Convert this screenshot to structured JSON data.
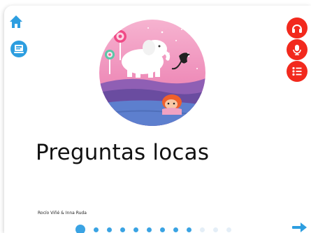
{
  "book": {
    "title": "Preguntas locas",
    "authors": "Rocío Viñé & Inna Ruda"
  },
  "icons": {
    "home": "home-icon",
    "library": "library-icon",
    "listen": "headphones-icon",
    "record": "microphone-icon",
    "contents": "list-icon",
    "next": "arrow-right-icon"
  },
  "pagination": {
    "total": 12,
    "current": 1
  },
  "colors": {
    "accent_blue": "#2d9ee0",
    "accent_red": "#f2291d",
    "dot_active": "#3aa3e3",
    "dot_inactive": "#e4eef7"
  }
}
